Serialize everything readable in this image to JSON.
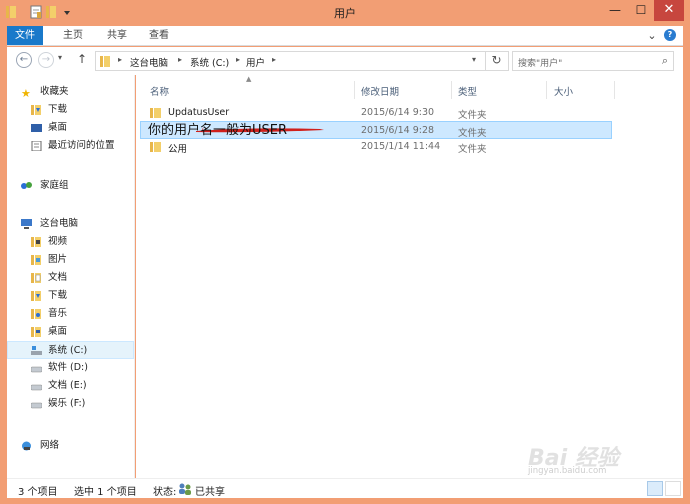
{
  "window": {
    "title": "用户",
    "minimize": "—",
    "maximize": "☐",
    "close": "✕"
  },
  "ribbon": {
    "tabs": [
      {
        "label": "文件"
      },
      {
        "label": "主页"
      },
      {
        "label": "共享"
      },
      {
        "label": "查看"
      }
    ],
    "expand": "⌄",
    "help": "?"
  },
  "address": {
    "back": "←",
    "forward": "→",
    "recent": "▾",
    "up": "↑",
    "crumbs": [
      "这台电脑",
      "系统 (C:)",
      "用户"
    ],
    "search_placeholder": "搜索\"用户\""
  },
  "nav": {
    "groups": [
      {
        "label": "收藏夹",
        "icon": "star-icon"
      },
      {
        "label": "下载",
        "icon": "download-folder-icon"
      },
      {
        "label": "桌面",
        "icon": "desktop-icon"
      },
      {
        "label": "最近访问的位置",
        "icon": "recent-places-icon"
      },
      {
        "label": "家庭组",
        "icon": "homegroup-icon"
      },
      {
        "label": "这台电脑",
        "icon": "computer-icon"
      },
      {
        "label": "视频",
        "icon": "videos-folder-icon"
      },
      {
        "label": "图片",
        "icon": "pictures-folder-icon"
      },
      {
        "label": "文档",
        "icon": "documents-folder-icon"
      },
      {
        "label": "下载",
        "icon": "download-folder-icon"
      },
      {
        "label": "音乐",
        "icon": "music-folder-icon"
      },
      {
        "label": "桌面",
        "icon": "desktop-folder-icon"
      },
      {
        "label": "系统 (C:)",
        "icon": "system-drive-icon"
      },
      {
        "label": "软件 (D:)",
        "icon": "drive-icon"
      },
      {
        "label": "文档 (E:)",
        "icon": "drive-icon"
      },
      {
        "label": "娱乐 (F:)",
        "icon": "drive-icon"
      },
      {
        "label": "网络",
        "icon": "network-icon"
      }
    ]
  },
  "columns": {
    "name": "名称",
    "date": "修改日期",
    "type": "类型",
    "size": "大小"
  },
  "files": [
    {
      "name": "UpdatusUser",
      "date": "2015/6/14 9:30",
      "type": "文件夹"
    },
    {
      "name": "",
      "date": "2015/6/14 9:28",
      "type": "文件夹"
    },
    {
      "name": "公用",
      "date": "2015/1/14 11:44",
      "type": "文件夹"
    }
  ],
  "annotation": "你的用户名一般为USER",
  "status": {
    "count": "3 个项目",
    "selected": "选中 1 个项目",
    "state_label": "状态:",
    "state_value": "已共享"
  },
  "watermark": {
    "brand": "Bai 经验",
    "sub": "jingyan.baidu.com"
  },
  "colors": {
    "window_frame": "#f29e74",
    "file_tab": "#1979ca",
    "selection": "#cde8ff",
    "close_button": "#c7463e",
    "annotation_arrow": "#d0201c"
  }
}
